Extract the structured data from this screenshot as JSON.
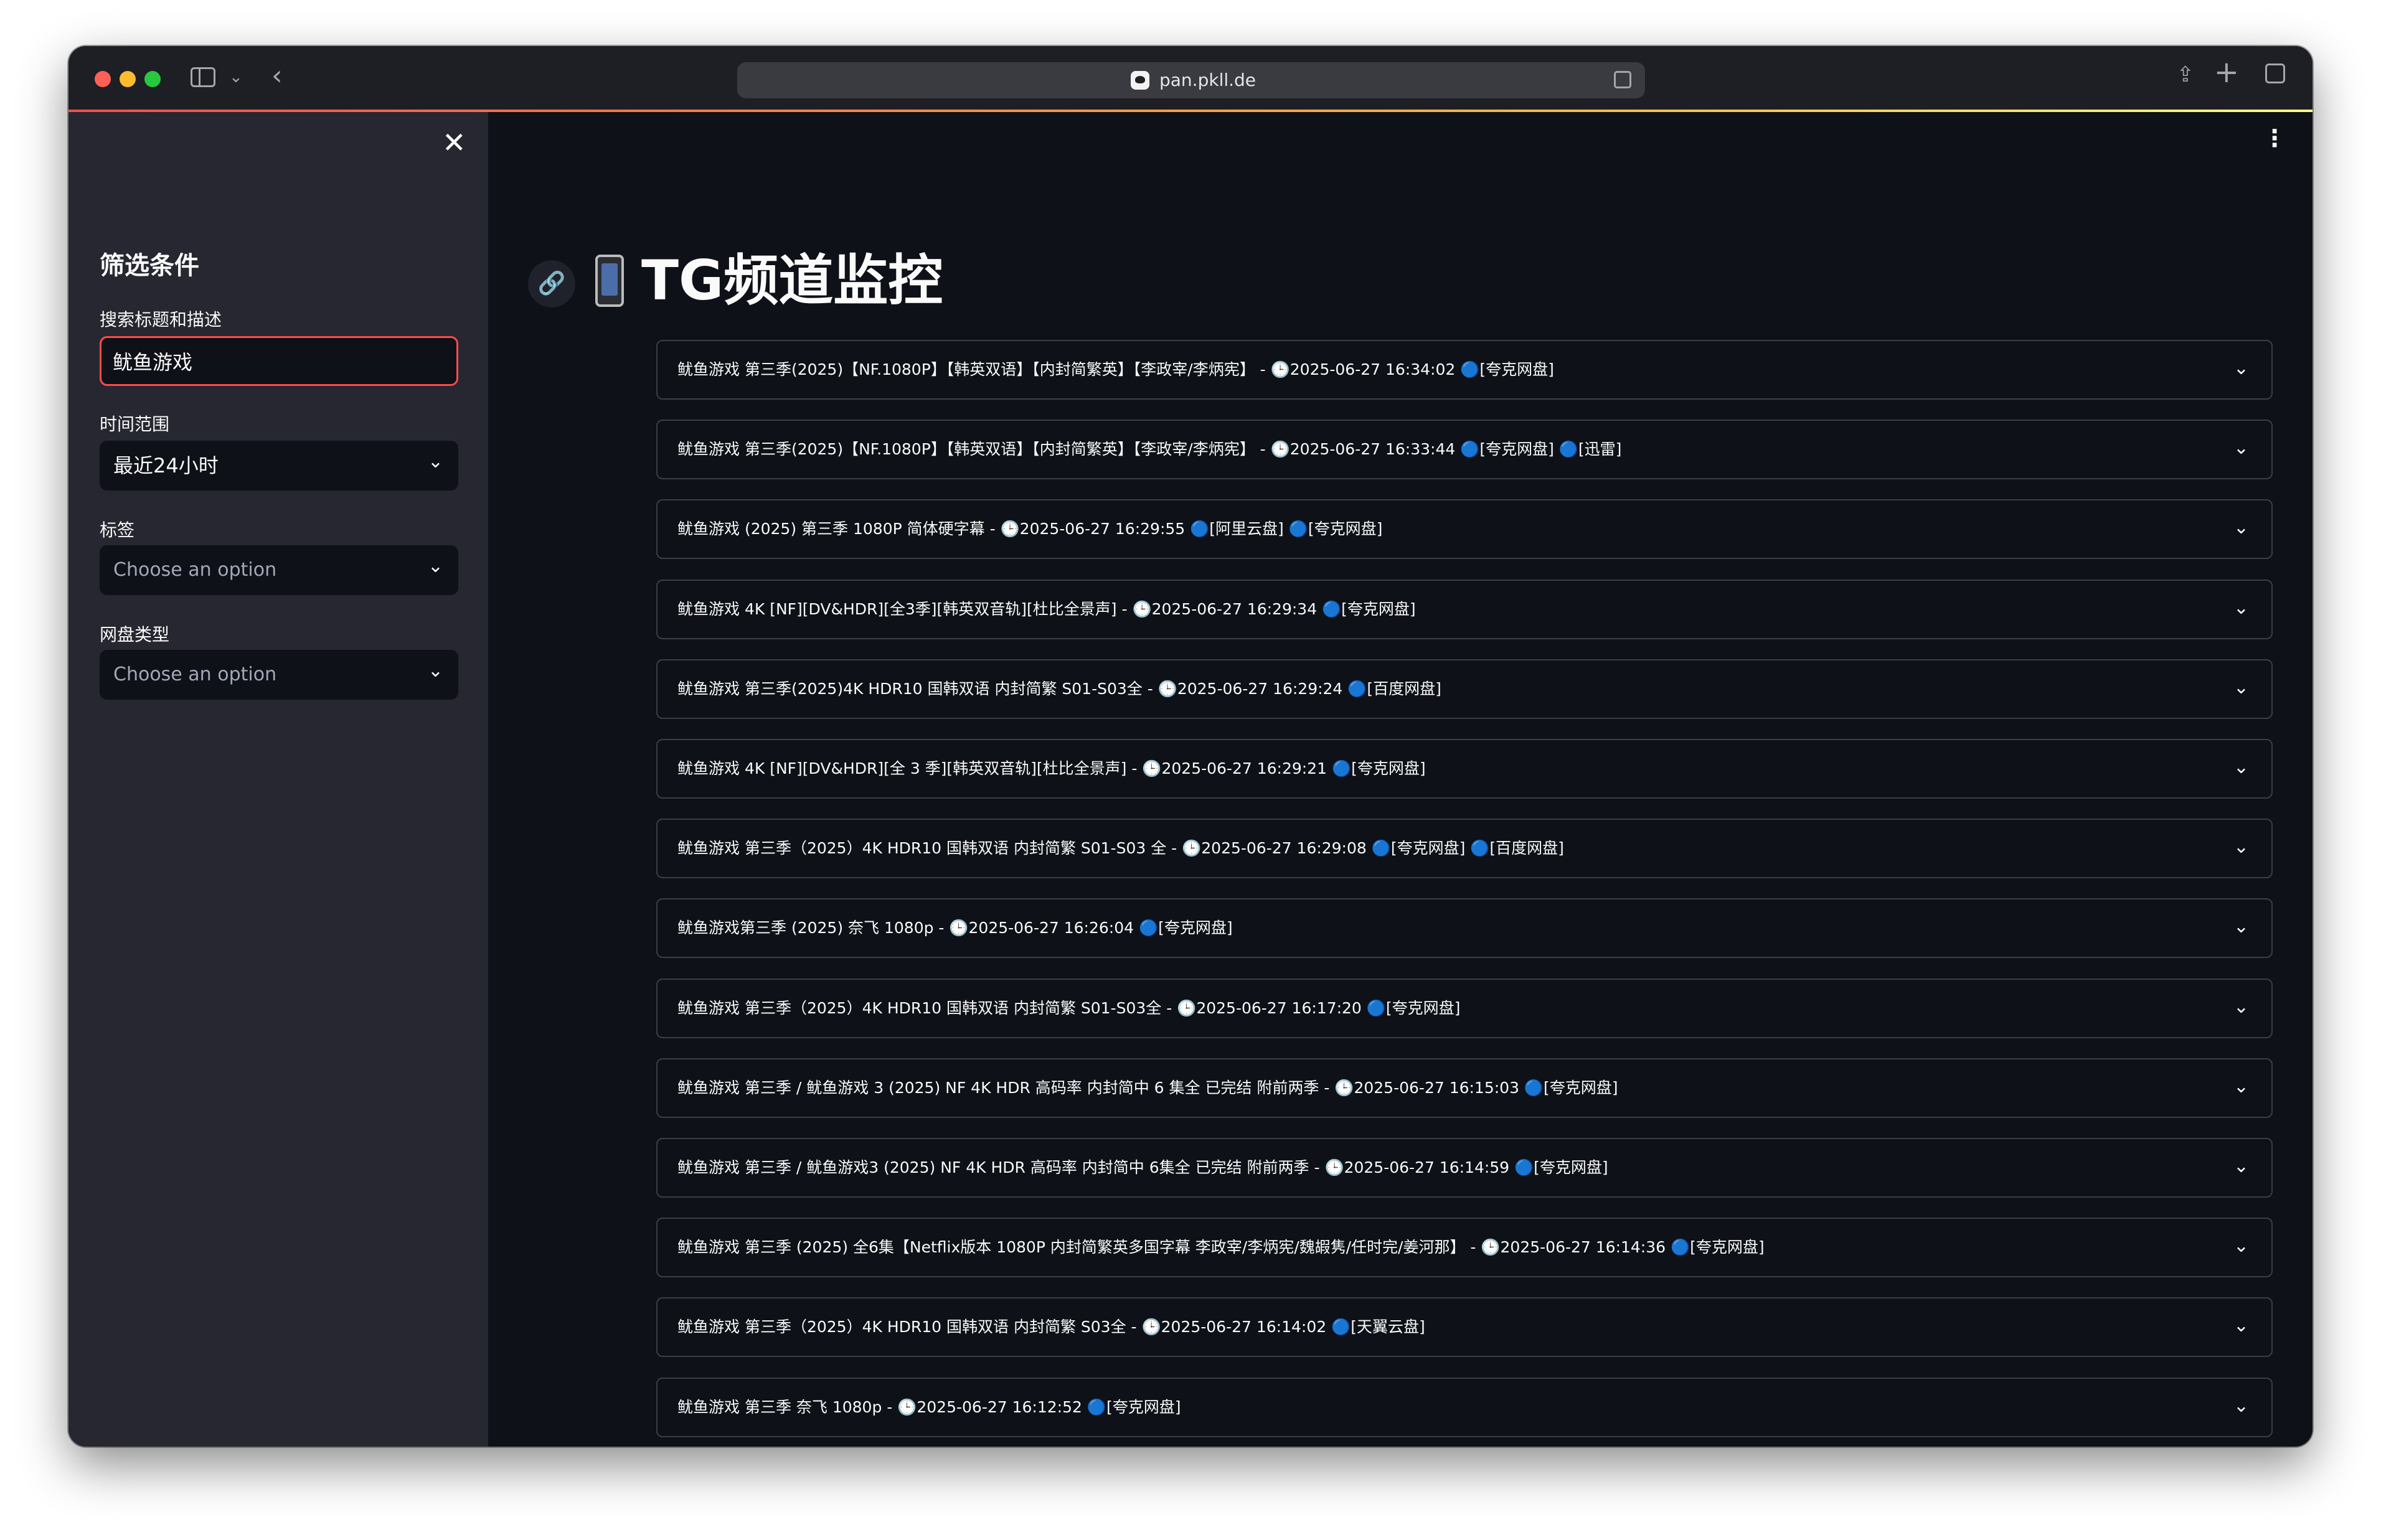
{
  "browser": {
    "url": "pan.pkll.de"
  },
  "sidebar": {
    "title": "筛选条件",
    "search_label": "搜索标题和描述",
    "search_value": "鱿鱼游戏",
    "time_label": "时间范围",
    "time_value": "最近24小时",
    "tags_label": "标签",
    "tags_placeholder": "Choose an option",
    "disk_label": "网盘类型",
    "disk_placeholder": "Choose an option"
  },
  "main": {
    "title": "TG频道监控",
    "items": [
      "鱿鱼游戏 第三季(2025)【NF.1080P】【韩英双语】【内封简繁英】【李政宰/李炳宪】 - 🕒2025-06-27 16:34:02 🔵[夸克网盘]",
      "鱿鱼游戏 第三季(2025)【NF.1080P】【韩英双语】【内封简繁英】【李政宰/李炳宪】 - 🕒2025-06-27 16:33:44 🔵[夸克网盘] 🔵[迅雷]",
      "鱿鱼游戏 (2025) 第三季 1080P 简体硬字幕 - 🕒2025-06-27 16:29:55 🔵[阿里云盘] 🔵[夸克网盘]",
      "鱿鱼游戏 4K [NF][DV&HDR][全3季][韩英双音轨][杜比全景声] - 🕒2025-06-27 16:29:34 🔵[夸克网盘]",
      "鱿鱼游戏 第三季(2025)4K HDR10 国韩双语 内封简繁 S01-S03全 - 🕒2025-06-27 16:29:24 🔵[百度网盘]",
      "鱿鱼游戏 4K [NF][DV&HDR][全 3 季][韩英双音轨][杜比全景声] - 🕒2025-06-27 16:29:21 🔵[夸克网盘]",
      "鱿鱼游戏 第三季（2025）4K HDR10 国韩双语 内封简繁 S01-S03 全 - 🕒2025-06-27 16:29:08 🔵[夸克网盘] 🔵[百度网盘]",
      "鱿鱼游戏第三季 (2025) 奈飞 1080p - 🕒2025-06-27 16:26:04 🔵[夸克网盘]",
      "鱿鱼游戏 第三季（2025）4K HDR10 国韩双语 内封简繁 S01-S03全 - 🕒2025-06-27 16:17:20 🔵[夸克网盘]",
      "鱿鱼游戏 第三季 / 鱿鱼游戏 3 (2025) NF 4K HDR 高码率 内封简中 6 集全 已完结 附前两季 - 🕒2025-06-27 16:15:03 🔵[夸克网盘]",
      "鱿鱼游戏 第三季 / 鱿鱼游戏3 (2025) NF 4K HDR 高码率 内封简中 6集全 已完结 附前两季 - 🕒2025-06-27 16:14:59 🔵[夸克网盘]",
      "鱿鱼游戏 第三季 (2025) 全6集【Netflix版本 1080P 内封简繁英多国字幕 李政宰/李炳宪/魏嘏隽/任时完/姜河那】 - 🕒2025-06-27 16:14:36 🔵[夸克网盘]",
      "鱿鱼游戏 第三季（2025）4K HDR10 国韩双语 内封简繁 S03全 - 🕒2025-06-27 16:14:02 🔵[天翼云盘]",
      "鱿鱼游戏 第三季 奈飞 1080p - 🕒2025-06-27 16:12:52 🔵[夸克网盘]"
    ]
  },
  "colors": {
    "accent": "#ff4b4b",
    "sidebar_bg": "#262730",
    "main_bg": "#0e1117",
    "border": "#3b3e47"
  }
}
